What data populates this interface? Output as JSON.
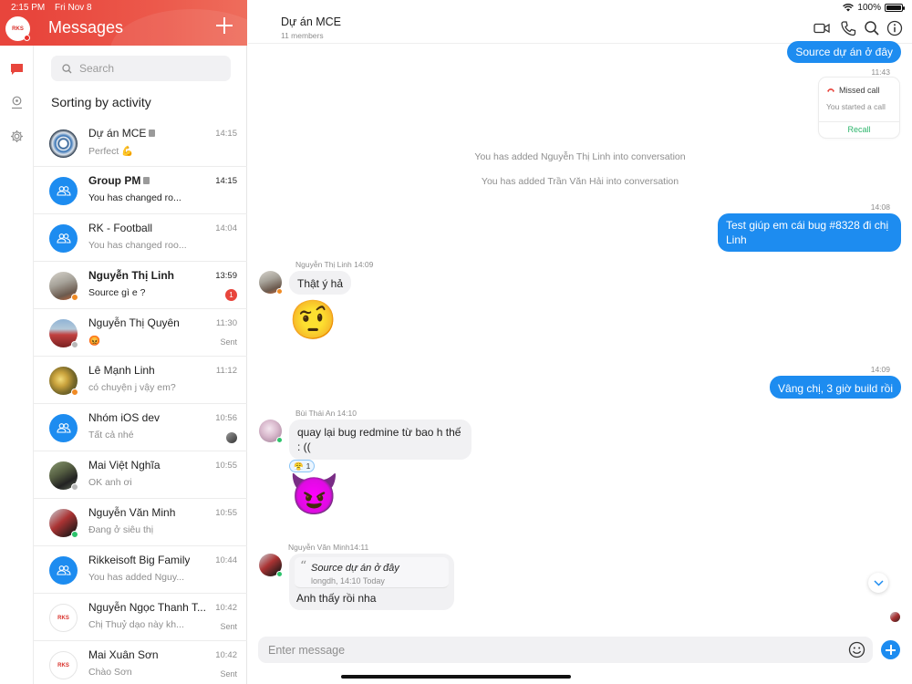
{
  "status_bar": {
    "time": "2:15 PM",
    "date": "Fri Nov 8",
    "battery": "100%"
  },
  "me": {
    "logo_text": "RKS"
  },
  "rail": {
    "icons": [
      "chat-icon",
      "map-pin-icon",
      "gear-icon"
    ]
  },
  "sidebar": {
    "title": "Messages",
    "add_icon": "plus-icon",
    "search_placeholder": "Search",
    "sort_title": "Sorting by activity"
  },
  "conversations": [
    {
      "name": "Dự án MCE",
      "preview": "Perfect 💪",
      "time": "14:15",
      "bold": false,
      "locked": true,
      "avatar": "photo1"
    },
    {
      "name": "Group PM",
      "preview": "You has changed ro...",
      "time": "14:15",
      "bold": true,
      "locked": true,
      "avatar": "group"
    },
    {
      "name": "RK - Football",
      "preview": "You has changed roo...",
      "time": "14:04",
      "bold": false,
      "locked": false,
      "avatar": "group"
    },
    {
      "name": "Nguyễn Thị Linh",
      "preview": "Source gì e ?",
      "time": "13:59",
      "bold": true,
      "unread": "1",
      "avatar": "photo2",
      "status": "orange"
    },
    {
      "name": "Nguyễn Thị Quyên",
      "preview": "😡",
      "time": "11:30",
      "sent": "Sent",
      "avatar": "photo3",
      "status": "grey"
    },
    {
      "name": "Lê Mạnh Linh",
      "preview": "có chuyện j vậy em?",
      "time": "11:12",
      "avatar": "photo4",
      "status": "orange"
    },
    {
      "name": "Nhóm iOS dev",
      "preview": "Tất cả nhé",
      "time": "10:56",
      "avatar": "group",
      "seen": true
    },
    {
      "name": "Mai Việt Nghĩa",
      "preview": "OK anh ơi",
      "time": "10:55",
      "avatar": "photo5",
      "status": "grey"
    },
    {
      "name": "Nguyễn Văn Minh",
      "preview": "Đang ở siêu thị",
      "time": "10:55",
      "avatar": "photo6",
      "status": "green"
    },
    {
      "name": "Rikkeisoft Big Family",
      "preview": "You has added Nguy...",
      "time": "10:44",
      "avatar": "group"
    },
    {
      "name": "Nguyễn Ngọc Thanh T...",
      "preview": "Chị Thuỷ dạo này kh...",
      "time": "10:42",
      "sent": "Sent",
      "avatar": "logo"
    },
    {
      "name": "Mai Xuân Sơn",
      "preview": "Chào Sơn",
      "time": "10:42",
      "sent": "Sent",
      "avatar": "logo"
    }
  ],
  "chat": {
    "title": "Dự án MCE",
    "members": "11 members",
    "header_icons": [
      "video-icon",
      "phone-icon",
      "search-icon",
      "info-icon"
    ],
    "msg_out_1": "Source dự án ở đây",
    "time_1143": "11:43",
    "call_card": {
      "title": "Missed call",
      "subtitle": "You started a call",
      "action": "Recall"
    },
    "sys_1": "You has added Nguyễn Thị Linh into conversation",
    "sys_2": "You has added Trần Văn Hải into conversation",
    "time_1408": "14:08",
    "msg_out_2": "Test giúp em cái bug #8328 đi chị Linh",
    "sender_linh": "Nguyễn Thị Linh 14:09",
    "msg_linh": "Thật ý hả",
    "emoji_linh": "🤨",
    "time_1409": "14:09",
    "msg_out_3": "Vâng chị, 3 giờ build rồi",
    "sender_an": "Bùi Thái An 14:10",
    "msg_an": "quay lại bug redmine từ bao h thế : ((",
    "reaction": {
      "emoji": "😤",
      "count": "1"
    },
    "emoji_an": "😈",
    "sender_minh": "Nguyễn Văn Minh14:11",
    "quote": {
      "text": "Source dự án ở đây",
      "meta": "longdh, 14:10 Today"
    },
    "msg_minh": "Anh thấy rồi nha",
    "composer_placeholder": "Enter message"
  }
}
